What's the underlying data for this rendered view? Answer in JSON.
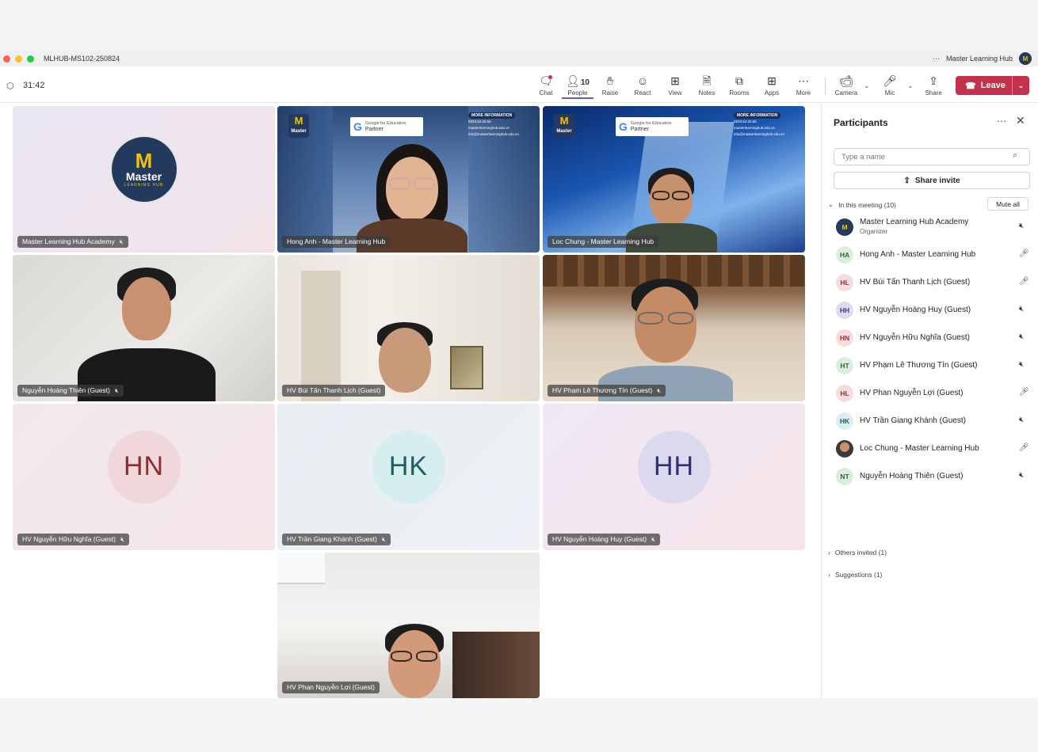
{
  "window": {
    "title": "MLHUB-MS102-250824",
    "account_name": "Master Learning Hub",
    "more_label": "···"
  },
  "toolbar": {
    "timer": "31:42",
    "buttons": [
      {
        "label": "Chat",
        "icon": "chat-icon"
      },
      {
        "label": "People",
        "icon": "people-icon",
        "count": "10"
      },
      {
        "label": "Raise",
        "icon": "hand-icon"
      },
      {
        "label": "React",
        "icon": "smile-icon"
      },
      {
        "label": "View",
        "icon": "grid-icon"
      },
      {
        "label": "Notes",
        "icon": "notes-icon"
      },
      {
        "label": "Rooms",
        "icon": "rooms-icon"
      },
      {
        "label": "Apps",
        "icon": "plus-icon"
      },
      {
        "label": "More",
        "icon": "ellipsis-icon"
      },
      {
        "label": "Camera",
        "icon": "camera-off-icon"
      },
      {
        "label": "Mic",
        "icon": "mic-off-icon"
      },
      {
        "label": "Share",
        "icon": "share-icon"
      }
    ],
    "leave_label": "Leave"
  },
  "tiles": [
    {
      "name": "Master Learning Hub Academy",
      "kind": "logo",
      "muted": true
    },
    {
      "name": "Hong Anh - Master Learning Hub",
      "kind": "video",
      "muted": false
    },
    {
      "name": "Loc Chung - Master Learning Hub",
      "kind": "video",
      "muted": false
    },
    {
      "name": "Nguyễn Hoàng Thiên (Guest)",
      "kind": "video",
      "muted": true
    },
    {
      "name": "HV Bùi Tấn Thanh Lịch (Guest)",
      "kind": "video",
      "muted": false
    },
    {
      "name": "HV Phạm Lê Thương Tín (Guest)",
      "kind": "video",
      "muted": true
    },
    {
      "name": "HV Nguyễn Hữu Nghĩa (Guest)",
      "kind": "initials",
      "initials": "HN",
      "muted": true
    },
    {
      "name": "HV Trần Giang Khánh (Guest)",
      "kind": "initials",
      "initials": "HK",
      "muted": true
    },
    {
      "name": "HV Nguyễn Hoàng Huy (Guest)",
      "kind": "initials",
      "initials": "HH",
      "muted": true
    },
    {
      "name": "HV Phan Nguyễn Lợi (Guest)",
      "kind": "video",
      "muted": false
    }
  ],
  "logo": {
    "letter": "M",
    "word": "Master",
    "tagline": "LEARNING HUB"
  },
  "branding": {
    "partner_line1": "Google for Education",
    "partner_line2": "Partner",
    "more_info": "MORE INFORMATION",
    "phone": "0933.54.20.55",
    "web": "masterlearninghub.edu.vn",
    "email": "info@masterlearninghub.edu.vn"
  },
  "panel": {
    "title": "Participants",
    "search_placeholder": "Type a name",
    "share_invite": "Share invite",
    "in_meeting": "In this meeting (10)",
    "mute_all": "Mute all",
    "others_invited": "Others invited (1)",
    "suggestions": "Suggestions (1)",
    "participants": [
      {
        "initials": "M",
        "name": "Master Learning Hub Academy",
        "role": "Organizer",
        "mic": "off",
        "bg": "#233a5e",
        "fg": "#f6c100"
      },
      {
        "initials": "HA",
        "name": "Hong Anh - Master Learning Hub",
        "role": "",
        "mic": "on",
        "bg": "#dbeedb",
        "fg": "#1f6b3a"
      },
      {
        "initials": "HL",
        "name": "HV Bùi Tấn Thanh Lịch (Guest)",
        "role": "",
        "mic": "on",
        "bg": "#f6dcdc",
        "fg": "#9a2f2f"
      },
      {
        "initials": "HH",
        "name": "HV Nguyễn Hoàng Huy (Guest)",
        "role": "",
        "mic": "off",
        "bg": "#dcdcf0",
        "fg": "#333a7a"
      },
      {
        "initials": "HN",
        "name": "HV Nguyễn Hữu Nghĩa (Guest)",
        "role": "",
        "mic": "off",
        "bg": "#f6dcdc",
        "fg": "#9a2f2f"
      },
      {
        "initials": "HT",
        "name": "HV Phạm Lê Thương Tín (Guest)",
        "role": "",
        "mic": "off",
        "bg": "#dbeedb",
        "fg": "#1f6b3a"
      },
      {
        "initials": "HL",
        "name": "HV Phan Nguyễn Lợi (Guest)",
        "role": "",
        "mic": "on",
        "bg": "#f6dcdc",
        "fg": "#9a2f2f"
      },
      {
        "initials": "HK",
        "name": "HV Trần Giang Khánh (Guest)",
        "role": "",
        "mic": "off",
        "bg": "#d9eff2",
        "fg": "#1e5e66"
      },
      {
        "initials": "",
        "name": "Loc Chung - Master Learning Hub",
        "role": "",
        "mic": "on",
        "bg": "#4a4a4a",
        "fg": "#fff"
      },
      {
        "initials": "NT",
        "name": "Nguyễn Hoàng Thiên (Guest)",
        "role": "",
        "mic": "off",
        "bg": "#dbeedb",
        "fg": "#1f6b3a"
      }
    ]
  },
  "colors": {
    "leave": "#c4314b",
    "accent": "#5b5fc7",
    "brand_navy": "#233a5e",
    "brand_gold": "#f6c100"
  }
}
